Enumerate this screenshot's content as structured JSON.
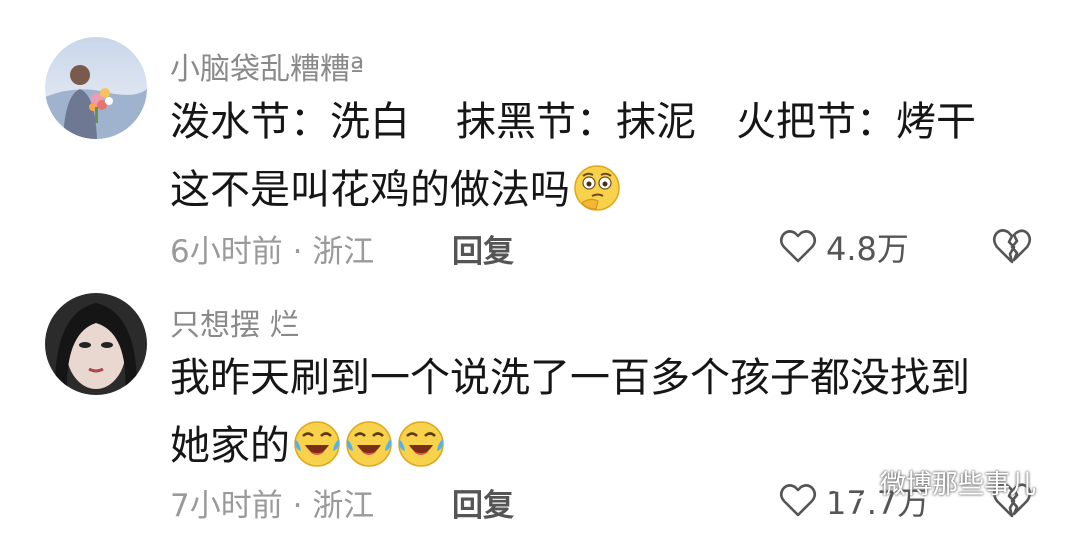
{
  "comments": [
    {
      "username": "小脑袋乱糟糟ª",
      "content_line1_parts": [
        "泼水节：洗白",
        "抹黑节：抹泥",
        "火把节：烤干"
      ],
      "content_line2": "这不是叫花鸡的做法吗",
      "emoji": "thinking-face-icon",
      "meta": "6小时前 · 浙江",
      "reply_label": "回复",
      "likes": "4.8万"
    },
    {
      "username": "只想摆 烂",
      "content_line1": "我昨天刷到一个说洗了一百多个孩子都没找到",
      "content_line2": "她家的",
      "emoji": "laughing-crying-face-icon",
      "meta": "7小时前 · 浙江",
      "reply_label": "回复",
      "likes": "17.7万"
    }
  ],
  "watermark": "微博那些事儿",
  "colors": {
    "username": "#8a8a8a",
    "meta": "#9a9a9a",
    "text": "#161616"
  }
}
